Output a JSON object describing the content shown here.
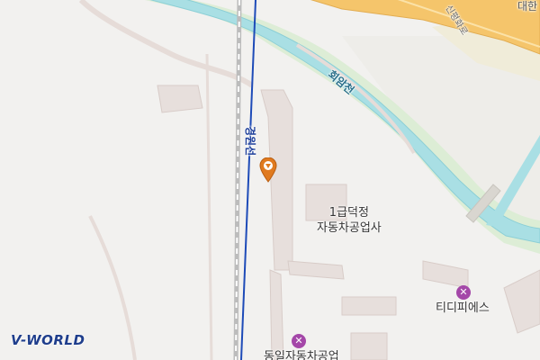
{
  "labels": {
    "corner_top_right": "대한",
    "road": "신평화로",
    "stream": "회암천",
    "rail": "경원선",
    "poi_main_line1": "1급덕정",
    "poi_main_line2": "자동차공업사",
    "poi_tdps": "티디피에스",
    "poi_bottom": "동일자동차공업"
  },
  "icons": {
    "location_marker": "location-pin-icon",
    "poi_tdps": "wrench-screwdriver-icon",
    "poi_bottom": "wrench-screwdriver-icon"
  },
  "logo": {
    "text": "V-WORLD"
  },
  "colors": {
    "background": "#f2f1ef",
    "major_road": "#f5c56b",
    "stream": "#a9dfe4",
    "rail_line": "#1e4bb8",
    "marker": "#e07a1f",
    "poi_icon": "#a447a8"
  }
}
